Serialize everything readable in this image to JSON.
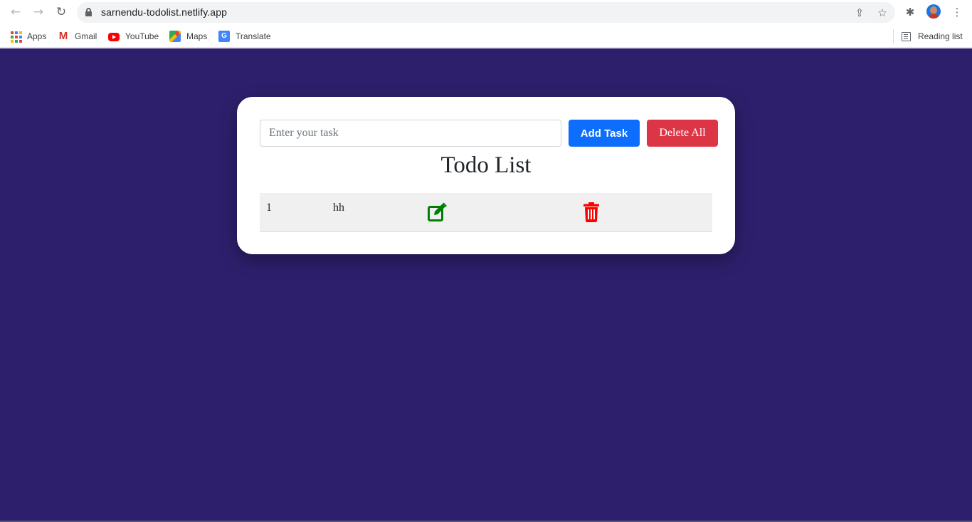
{
  "browser": {
    "url": "sarnendu-todolist.netlify.app",
    "bookmarks": [
      {
        "label": "Apps",
        "icon": "apps-grid-icon"
      },
      {
        "label": "Gmail",
        "icon": "gmail-icon"
      },
      {
        "label": "YouTube",
        "icon": "youtube-icon"
      },
      {
        "label": "Maps",
        "icon": "maps-icon"
      },
      {
        "label": "Translate",
        "icon": "translate-icon"
      }
    ],
    "reading_list": "Reading list"
  },
  "app": {
    "input_placeholder": "Enter your task",
    "input_value": "",
    "add_button": "Add Task",
    "delete_all_button": "Delete All",
    "title": "Todo List",
    "tasks": [
      {
        "number": "1",
        "text": "hh"
      }
    ]
  },
  "colors": {
    "page_background": "#2e1f6c",
    "add_button": "#0d6efd",
    "delete_all_button": "#dc3545",
    "edit_icon": "#008000",
    "trash_icon": "#ff0000"
  }
}
